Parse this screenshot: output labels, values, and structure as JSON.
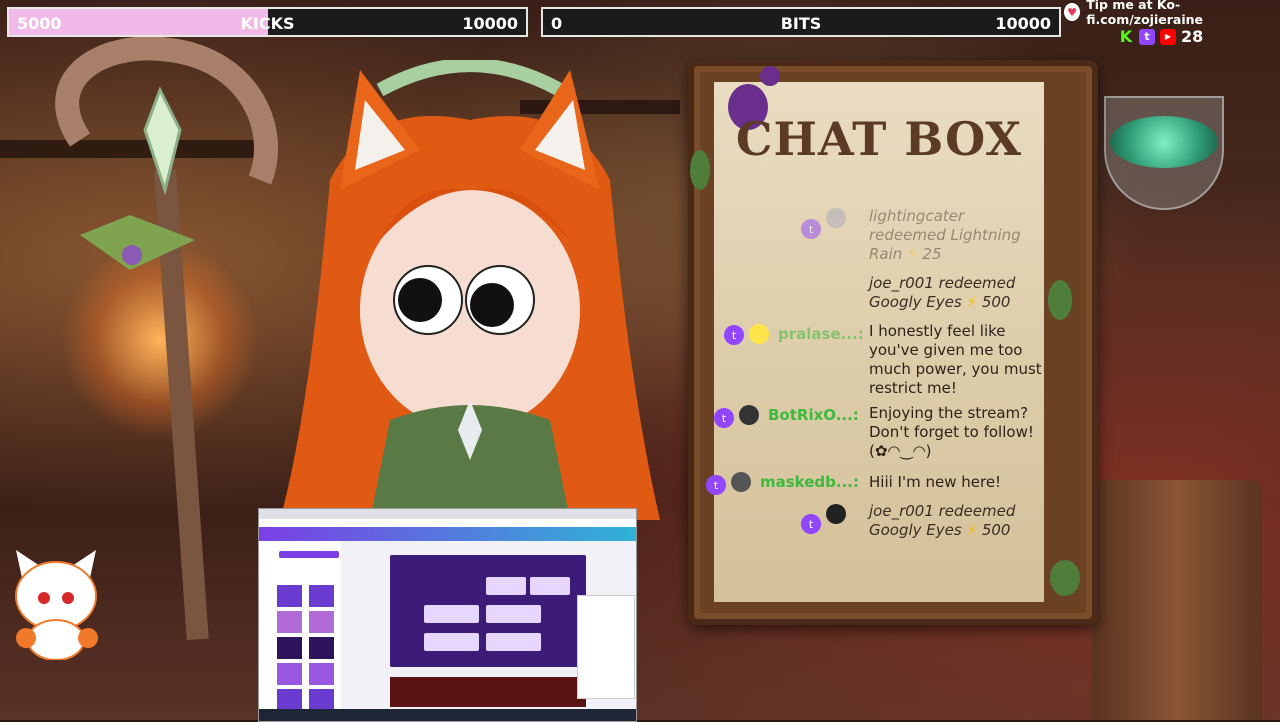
{
  "goals": {
    "kicks": {
      "current": "5000",
      "label": "KICKS",
      "max": "10000",
      "progress": 0.5
    },
    "bits": {
      "current": "0",
      "label": "BITS",
      "max": "10000",
      "progress": 0
    }
  },
  "kofi": {
    "text": "Tip me at Ko-fi.com/zojieraine"
  },
  "viewers": {
    "count": "28"
  },
  "chatbox": {
    "title": "CHAT BOX",
    "messages": [
      {
        "type": "redeem",
        "faded": true,
        "text1": "lightingcater",
        "text2": "redeemed Lightning",
        "text3": "Rain",
        "points": "25"
      },
      {
        "type": "redeem",
        "faded": false,
        "text1": "joe_r001 redeemed",
        "text2": "Googly Eyes",
        "points": "500"
      },
      {
        "type": "chat",
        "user": "pralase...:",
        "lines": [
          "I honestly feel like",
          "you've given me too",
          "much power, you must",
          "restrict me!"
        ]
      },
      {
        "type": "chat",
        "user": "BotRixO...:",
        "lines": [
          "Enjoying the stream?",
          "Don't forget to follow!",
          "(✿◠‿◠)"
        ]
      },
      {
        "type": "chat",
        "user": "maskedb...:",
        "lines": [
          "Hiii I'm new here!"
        ]
      },
      {
        "type": "redeem",
        "faded": false,
        "text1": "joe_r001 redeemed",
        "text2": "Googly Eyes",
        "points": "500"
      }
    ]
  },
  "colors": {
    "kicks_fill": "#f0b9e7",
    "twitch_purple": "#9146ff",
    "chat_username": "#3dba3b",
    "kick_green": "#53fc18"
  }
}
